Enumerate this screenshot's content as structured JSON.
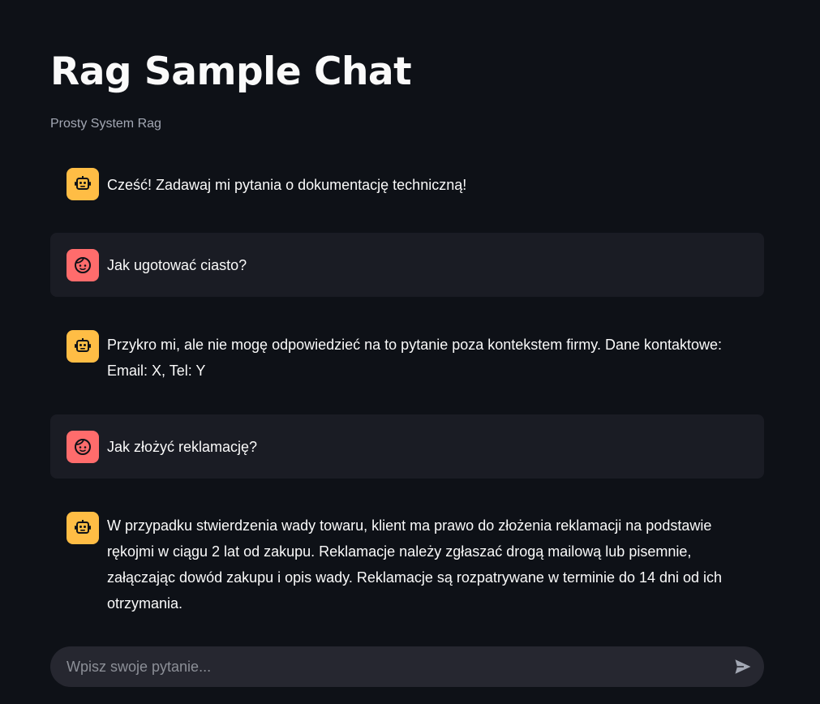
{
  "app": {
    "title": "Rag Sample Chat",
    "subtitle": "Prosty System Rag"
  },
  "messages": [
    {
      "role": "assistant",
      "avatar_icon": "robot-icon",
      "text": "Cześć! Zadawaj mi pytania o dokumentację techniczną!"
    },
    {
      "role": "user",
      "avatar_icon": "face-icon",
      "text": "Jak ugotować ciasto?"
    },
    {
      "role": "assistant",
      "avatar_icon": "robot-icon",
      "text": "Przykro mi, ale nie mogę odpowiedzieć na to pytanie poza kontekstem firmy. Dane kontaktowe: Email: X, Tel: Y"
    },
    {
      "role": "user",
      "avatar_icon": "face-icon",
      "text": "Jak złożyć reklamację?"
    },
    {
      "role": "assistant",
      "avatar_icon": "robot-icon",
      "text": "W przypadku stwierdzenia wady towaru, klient ma prawo do złożenia reklamacji na podstawie rękojmi w ciągu 2 lat od zakupu. Reklamacje należy zgłaszać drogą mailową lub pisemnie, załączając dowód zakupu i opis wady. Reklamacje są rozpatrywane w terminie do 14 dni od ich otrzymania."
    }
  ],
  "chat_input": {
    "value": "",
    "placeholder": "Wpisz swoje pytanie...",
    "send_icon": "send-icon"
  },
  "colors": {
    "background": "#0e1117",
    "assistant_avatar": "#ffbd45",
    "user_avatar": "#ff6c6c",
    "user_message_bg": "#1a1c24",
    "input_bg": "#262730"
  }
}
